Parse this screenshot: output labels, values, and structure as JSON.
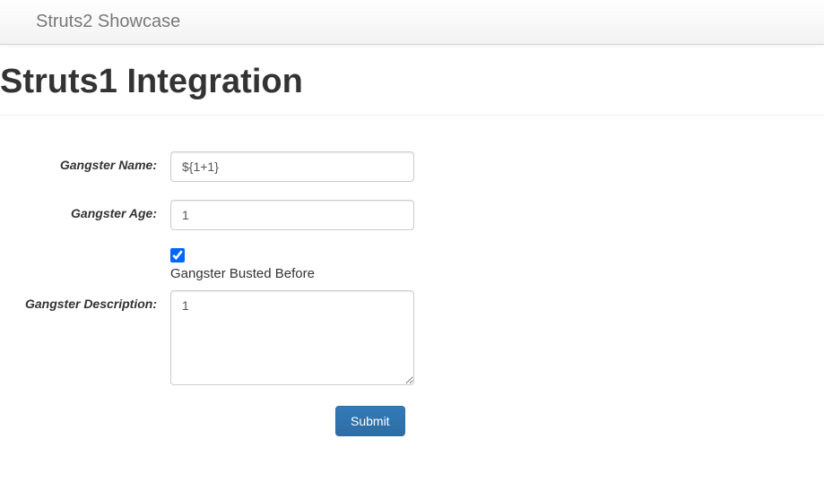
{
  "navbar": {
    "brand": "Struts2 Showcase"
  },
  "page": {
    "title": "Struts1 Integration"
  },
  "form": {
    "name": {
      "label": "Gangster Name:",
      "value": "${1+1}"
    },
    "age": {
      "label": "Gangster Age:",
      "value": "1"
    },
    "busted": {
      "label": "Gangster Busted Before",
      "checked": true
    },
    "description": {
      "label": "Gangster Description:",
      "value": "1"
    },
    "submit": {
      "label": "Submit"
    }
  }
}
